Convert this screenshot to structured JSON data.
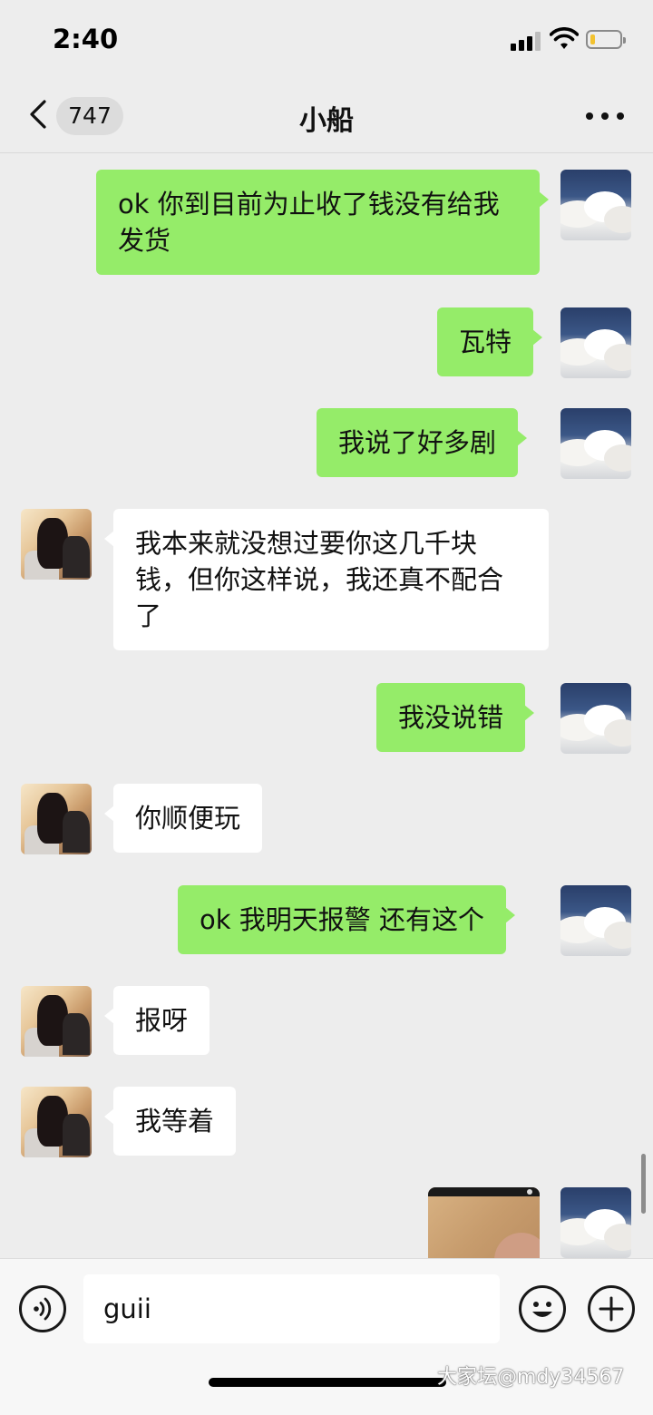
{
  "status_bar": {
    "time": "2:40"
  },
  "header": {
    "badge_count": "747",
    "title": "小船"
  },
  "messages": [
    {
      "from": "me",
      "text": "ok 你到目前为止收了钱没有给我发货"
    },
    {
      "from": "me",
      "text": "瓦特"
    },
    {
      "from": "me",
      "text": "我说了好多剧"
    },
    {
      "from": "other",
      "text": "我本来就没想过要你这几千块钱，但你这样说，我还真不配合了"
    },
    {
      "from": "me",
      "text": "我没说错"
    },
    {
      "from": "other",
      "text": "你顺便玩"
    },
    {
      "from": "me",
      "text": "ok 我明天报警 还有这个"
    },
    {
      "from": "other",
      "text": "报呀"
    },
    {
      "from": "other",
      "text": "我等着"
    },
    {
      "from": "me",
      "type": "image"
    }
  ],
  "input": {
    "value": "guii"
  },
  "watermark": "大家坛@mdy34567",
  "icons": {
    "back": "chevron-left-icon",
    "more": "more-dots-icon",
    "voice": "voice-icon",
    "emoji": "emoji-icon",
    "plus": "plus-icon"
  },
  "colors": {
    "background": "#ededed",
    "my_bubble": "#95ec69",
    "other_bubble": "#ffffff"
  }
}
